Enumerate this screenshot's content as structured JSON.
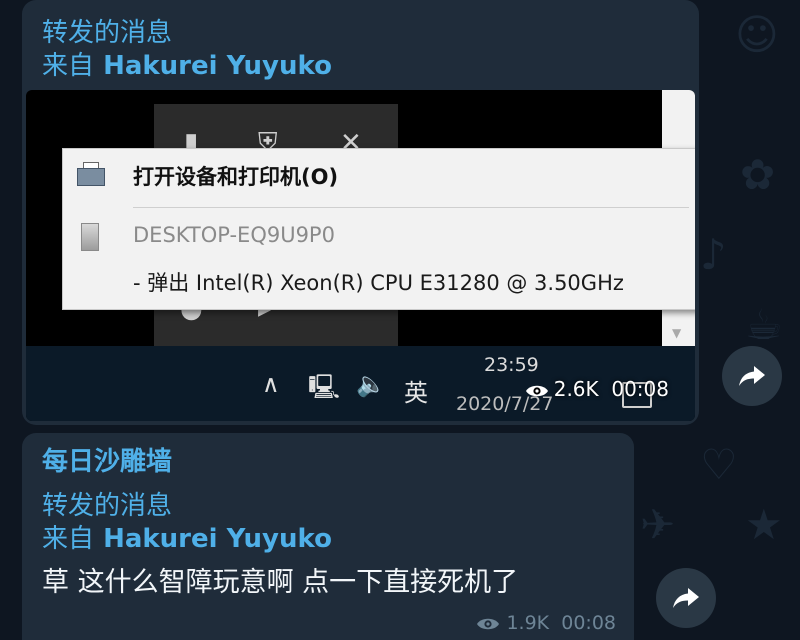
{
  "messages": [
    {
      "forwarded_label": "转发的消息",
      "from_prefix": "来自",
      "from_name": "Hakurei Yuyuko",
      "photo": {
        "menu_item_open": "打开设备和打印机(O)",
        "menu_item_device": "DESKTOP-EQ9U9P0",
        "menu_item_eject": "- 弹出 Intel(R) Xeon(R) CPU E31280 @ 3.50GHz",
        "taskbar_ime": "英",
        "taskbar_time": "23:59",
        "taskbar_date": "2020/7/27"
      },
      "views": "2.6K",
      "time": "00:08"
    },
    {
      "channel_name": "每日沙雕墙",
      "forwarded_label": "转发的消息",
      "from_prefix": "来自",
      "from_name": "Hakurei Yuyuko",
      "text": "草 这什么智障玩意啊 点一下直接死机了",
      "views": "1.9K",
      "time": "00:08"
    }
  ],
  "icons": {
    "eye": "eye-icon",
    "share": "share-arrow-icon",
    "tray_up": "chevron-up-icon",
    "network": "network-icon",
    "volume": "volume-icon",
    "notification": "notification-icon"
  },
  "colors": {
    "background": "#0e1621",
    "bubble": "#1f2c3a",
    "accent_link": "#4fb0e8",
    "meta_text": "#6e8596"
  }
}
